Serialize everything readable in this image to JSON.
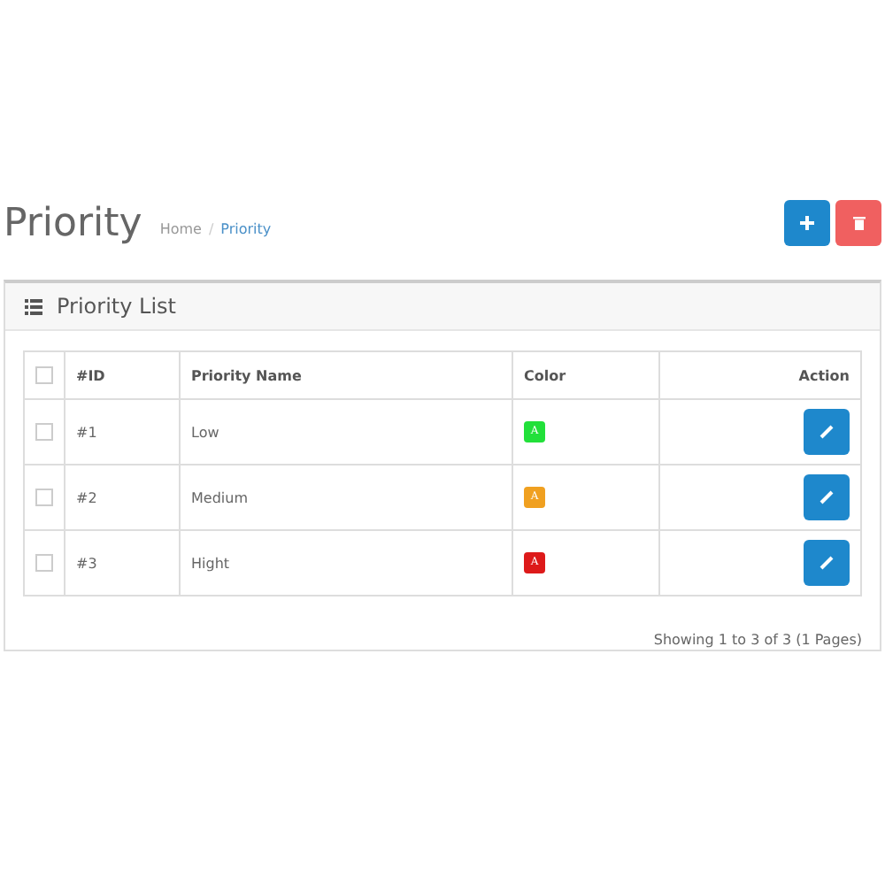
{
  "page": {
    "title": "Priority",
    "breadcrumb": [
      "Home",
      "Priority"
    ],
    "breadcrumb_separator": "/"
  },
  "panel": {
    "title": "Priority List"
  },
  "table": {
    "columns": [
      "#ID",
      "Priority Name",
      "Color",
      "Action"
    ],
    "header_checked": false,
    "rows": [
      {
        "id": "#1",
        "name": "Low",
        "swatch": "A",
        "color": "#22e03a",
        "checked": false
      },
      {
        "id": "#2",
        "name": "Medium",
        "swatch": "A",
        "color": "#f0a020",
        "checked": false
      },
      {
        "id": "#3",
        "name": "Hight",
        "swatch": "A",
        "color": "#dd1a1a",
        "checked": false
      }
    ]
  },
  "pagination": "Showing 1 to 3 of 3 (1 Pages)"
}
